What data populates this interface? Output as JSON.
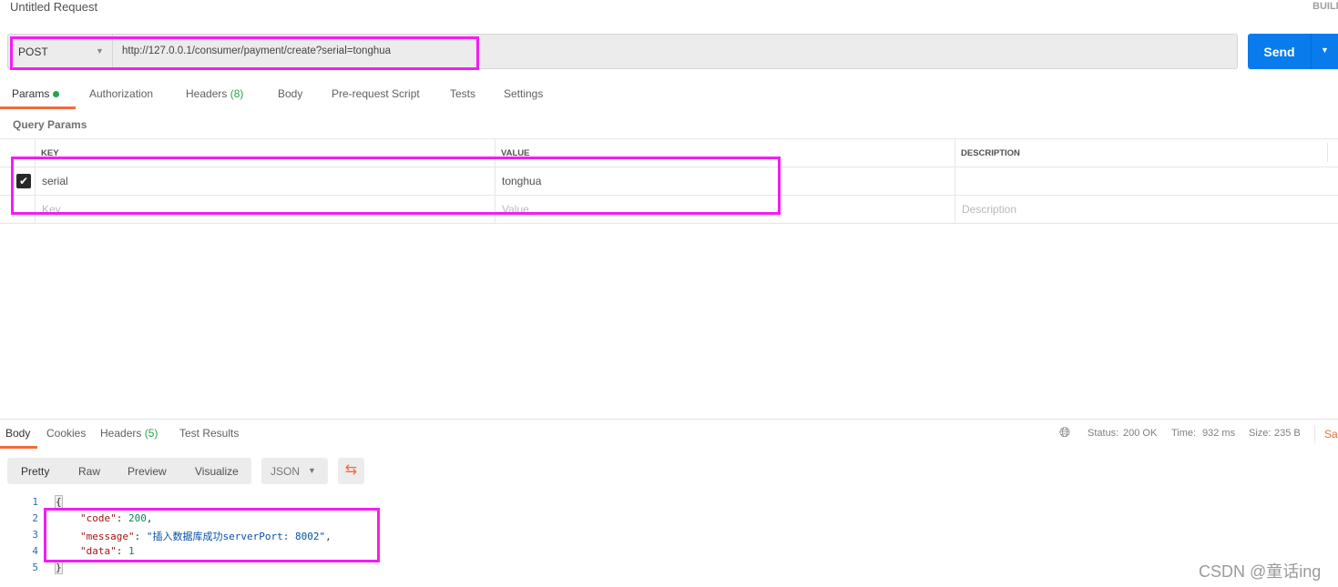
{
  "header": {
    "title": "Untitled Request",
    "build_label": "BUILD"
  },
  "request": {
    "method": "POST",
    "url": "http://127.0.0.1/consumer/payment/create?serial=tonghua",
    "send_label": "Send"
  },
  "tabs": [
    {
      "label": "Params",
      "dot": true
    },
    {
      "label": "Authorization"
    },
    {
      "label": "Headers",
      "count": "(8)"
    },
    {
      "label": "Body"
    },
    {
      "label": "Pre-request Script"
    },
    {
      "label": "Tests"
    },
    {
      "label": "Settings"
    }
  ],
  "params": {
    "section_title": "Query Params",
    "columns": [
      "KEY",
      "VALUE",
      "DESCRIPTION"
    ],
    "rows": [
      {
        "checked": true,
        "key": "serial",
        "value": "tonghua",
        "description": ""
      }
    ],
    "placeholders": {
      "key": "Key",
      "value": "Value",
      "description": "Description"
    }
  },
  "response": {
    "tabs": [
      {
        "label": "Body"
      },
      {
        "label": "Cookies"
      },
      {
        "label": "Headers",
        "count": "(5)"
      },
      {
        "label": "Test Results"
      }
    ],
    "status_label": "Status:",
    "status": "200 OK",
    "time_label": "Time:",
    "time": "932 ms",
    "size_label": "Size:",
    "size": "235 B",
    "save_label": "Sa",
    "views": [
      "Pretty",
      "Raw",
      "Preview",
      "Visualize"
    ],
    "format": "JSON",
    "lines": [
      {
        "n": "1",
        "text": "{"
      },
      {
        "n": "2",
        "key": "\"code\"",
        "sep": ": ",
        "val": "200",
        "end": ","
      },
      {
        "n": "3",
        "key": "\"message\"",
        "sep": ": ",
        "val": "\"插入数据库成功serverPort: 8002\"",
        "end": ","
      },
      {
        "n": "4",
        "key": "\"data\"",
        "sep": ": ",
        "val": "1",
        "end": ""
      },
      {
        "n": "5",
        "text": "}"
      }
    ]
  },
  "watermark": "CSDN @童话ing",
  "colors": {
    "accent": "#f26b3a",
    "send": "#097bed",
    "success": "#26a34a",
    "highlight": "#f41cf4"
  }
}
